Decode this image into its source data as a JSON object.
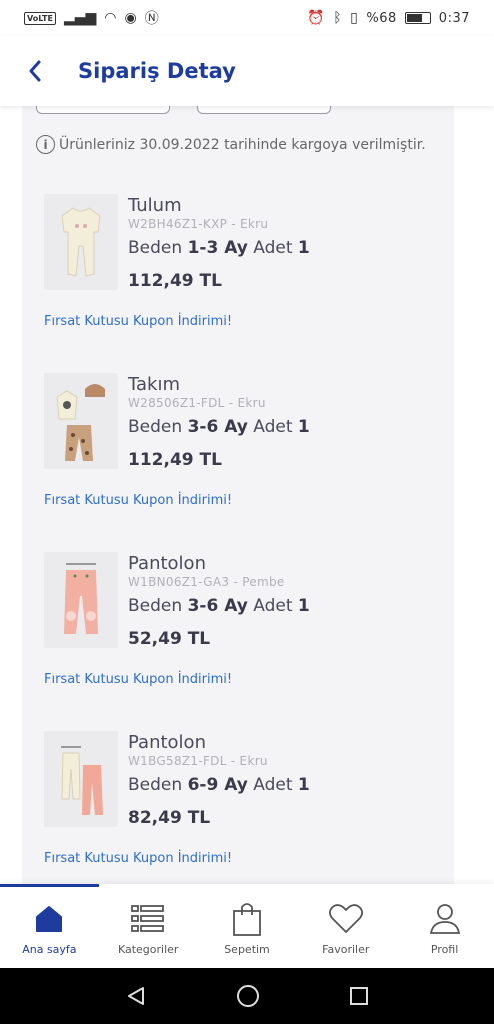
{
  "status_bar": {
    "left_label": "VoLTE",
    "battery_text": "%68",
    "time": "0:37"
  },
  "header": {
    "title": "Sipariş Detay"
  },
  "shipping": {
    "info_text": "Ürünleriniz 30.09.2022 tarihinde kargoya verilmiştir."
  },
  "labels": {
    "size": "Beden",
    "qty": "Adet"
  },
  "items": [
    {
      "name": "Tulum",
      "sku": "W2BH46Z1-KXP - Ekru",
      "size": "1-3 Ay",
      "qty": "1",
      "price": "112,49 TL",
      "coupon": "Fırsat Kutusu Kupon İndirimi!"
    },
    {
      "name": "Takım",
      "sku": "W28506Z1-FDL - Ekru",
      "size": "3-6 Ay",
      "qty": "1",
      "price": "112,49 TL",
      "coupon": "Fırsat Kutusu Kupon İndirimi!"
    },
    {
      "name": "Pantolon",
      "sku": "W1BN06Z1-GA3 - Pembe",
      "size": "3-6 Ay",
      "qty": "1",
      "price": "52,49 TL",
      "coupon": "Fırsat Kutusu Kupon İndirimi!"
    },
    {
      "name": "Pantolon",
      "sku": "W1BG58Z1-FDL - Ekru",
      "size": "6-9 Ay",
      "qty": "1",
      "price": "82,49 TL",
      "coupon": "Fırsat Kutusu Kupon İndirimi!"
    }
  ],
  "bottom_nav": [
    {
      "label": "Ana sayfa",
      "icon": "home-icon",
      "active": true
    },
    {
      "label": "Kategoriler",
      "icon": "categories-icon"
    },
    {
      "label": "Sepetim",
      "icon": "bag-icon"
    },
    {
      "label": "Favoriler",
      "icon": "heart-icon"
    },
    {
      "label": "Profil",
      "icon": "profile-icon"
    }
  ],
  "colors": {
    "brand": "#1e3c9e",
    "link": "#2f6ec8",
    "panel": "#f4f4f6"
  }
}
